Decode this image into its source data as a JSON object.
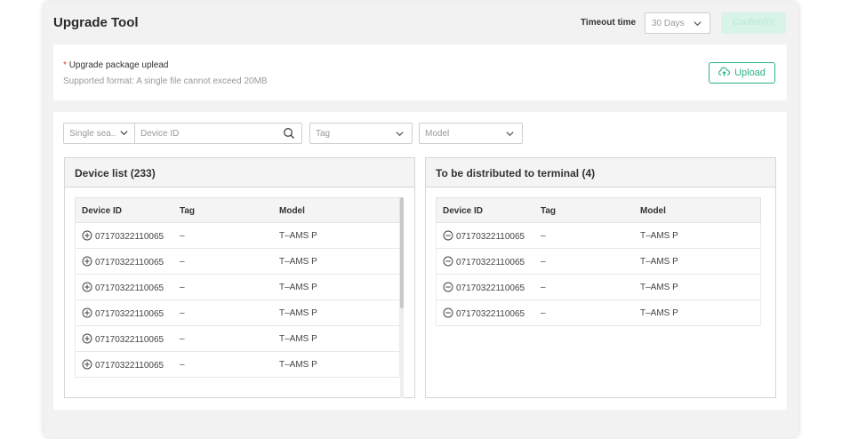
{
  "header": {
    "title": "Upgrade Tool",
    "timeout_label": "Timeout time",
    "timeout_value": "30 Days",
    "confirm_label": "Confirm(0)"
  },
  "upload": {
    "required_mark": "*",
    "label": "Upgrade package uplead",
    "hint": "Supported format: A single file cannot exceed 20MB",
    "button_label": "Upload"
  },
  "filters": {
    "search_mode": "Single sea..",
    "search_placeholder": "Device ID",
    "tag_placeholder": "Tag",
    "model_placeholder": "Model"
  },
  "device_list": {
    "title": "Device list (233)",
    "columns": [
      "Device ID",
      "Tag",
      "Model"
    ],
    "rows": [
      {
        "id": "07170322110065",
        "tag": "–",
        "model": "T–AMS P"
      },
      {
        "id": "07170322110065",
        "tag": "–",
        "model": "T–AMS P"
      },
      {
        "id": "07170322110065",
        "tag": "–",
        "model": "T–AMS P"
      },
      {
        "id": "07170322110065",
        "tag": "–",
        "model": "T–AMS P"
      },
      {
        "id": "07170322110065",
        "tag": "–",
        "model": "T–AMS P"
      },
      {
        "id": "07170322110065",
        "tag": "–",
        "model": "T–AMS P"
      }
    ]
  },
  "distribute_list": {
    "title": "To be distributed to terminal (4)",
    "columns": [
      "Device ID",
      "Tag",
      "Model"
    ],
    "rows": [
      {
        "id": "07170322110065",
        "tag": "–",
        "model": "T–AMS P"
      },
      {
        "id": "07170322110065",
        "tag": "–",
        "model": "T–AMS P"
      },
      {
        "id": "07170322110065",
        "tag": "–",
        "model": "T–AMS P"
      },
      {
        "id": "07170322110065",
        "tag": "–",
        "model": "T–AMS P"
      }
    ]
  },
  "colors": {
    "accent": "#2bb37f",
    "confirm_disabled_bg": "#d8f3e8",
    "required": "#e23b3b"
  },
  "icons": {
    "add": "plus-circle-icon",
    "remove": "minus-circle-icon",
    "search": "search-icon",
    "upload": "cloud-upload-icon",
    "dropdown": "chevron-down-icon"
  }
}
